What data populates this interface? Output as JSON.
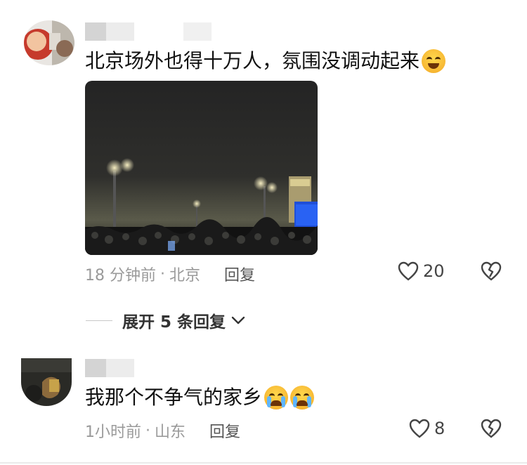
{
  "comments": [
    {
      "text": "北京场外也得十万人，氛围没调动起来",
      "emojis": [
        "rolling-laughing-face"
      ],
      "meta": {
        "time": "18 分钟前",
        "location": "北京"
      },
      "reply_label": "回复",
      "likes": "20"
    },
    {
      "text": "我那个不争气的家乡",
      "emojis": [
        "crying-face",
        "crying-face"
      ],
      "meta": {
        "time": "1小时前",
        "location": "山东"
      },
      "reply_label": "回复",
      "likes": "8"
    }
  ],
  "expand": {
    "label": "展开 5 条回复"
  },
  "colors": {
    "meta_text": "#9a9a9a",
    "body_text": "#111111",
    "reply": "#555555"
  }
}
